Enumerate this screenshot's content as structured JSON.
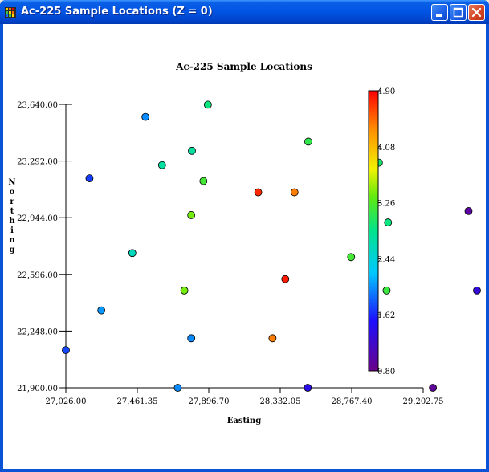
{
  "window": {
    "title": "Ac-225 Sample Locations (Z = 0)"
  },
  "chart_data": {
    "type": "scatter",
    "title": "Ac-225 Sample Locations",
    "xlabel": "Easting",
    "ylabel": "Northing",
    "xlim": [
      27026.0,
      29202.75
    ],
    "ylim": [
      21900.0,
      23640.0
    ],
    "x_ticks": [
      "27,026.00",
      "27,461.35",
      "27,896.70",
      "28,332.05",
      "28,767.40",
      "29,202.75"
    ],
    "y_ticks": [
      "23,640.00",
      "23,292.00",
      "22,944.00",
      "22,596.00",
      "22,248.00",
      "21,900.00"
    ],
    "colorbar": {
      "min": 0.8,
      "max": 4.9,
      "ticks": [
        "4.90",
        "4.08",
        "3.26",
        "2.44",
        "1.62",
        "0.80"
      ]
    },
    "points": [
      {
        "x": 27026,
        "y": 22131,
        "z": 1.75
      },
      {
        "x": 27242,
        "y": 22375,
        "z": 2.05
      },
      {
        "x": 27170,
        "y": 23186,
        "z": 1.7
      },
      {
        "x": 27431,
        "y": 22727,
        "z": 2.6
      },
      {
        "x": 27511,
        "y": 23563,
        "z": 2.0
      },
      {
        "x": 27612,
        "y": 23267,
        "z": 2.75
      },
      {
        "x": 27708,
        "y": 21900,
        "z": 2.0
      },
      {
        "x": 27748,
        "y": 22497,
        "z": 3.4
      },
      {
        "x": 27790,
        "y": 22204,
        "z": 2.0
      },
      {
        "x": 27790,
        "y": 22960,
        "z": 3.4
      },
      {
        "x": 27794,
        "y": 23355,
        "z": 2.75
      },
      {
        "x": 27864,
        "y": 23169,
        "z": 3.2
      },
      {
        "x": 27891,
        "y": 23638,
        "z": 2.9
      },
      {
        "x": 28198,
        "y": 23100,
        "z": 4.75
      },
      {
        "x": 28285,
        "y": 22204,
        "z": 4.4
      },
      {
        "x": 28363,
        "y": 22567,
        "z": 4.8
      },
      {
        "x": 28419,
        "y": 23100,
        "z": 4.4
      },
      {
        "x": 28500,
        "y": 21900,
        "z": 1.4
      },
      {
        "x": 28503,
        "y": 23411,
        "z": 3.1
      },
      {
        "x": 28764,
        "y": 22702,
        "z": 3.2
      },
      {
        "x": 28933,
        "y": 23282,
        "z": 2.95
      },
      {
        "x": 28980,
        "y": 22497,
        "z": 3.15
      },
      {
        "x": 28989,
        "y": 22915,
        "z": 2.9
      },
      {
        "x": 29262,
        "y": 21900,
        "z": 0.9
      },
      {
        "x": 29479,
        "y": 22985,
        "z": 0.95
      },
      {
        "x": 29586,
        "y": 22497,
        "z": 1.3
      }
    ]
  }
}
